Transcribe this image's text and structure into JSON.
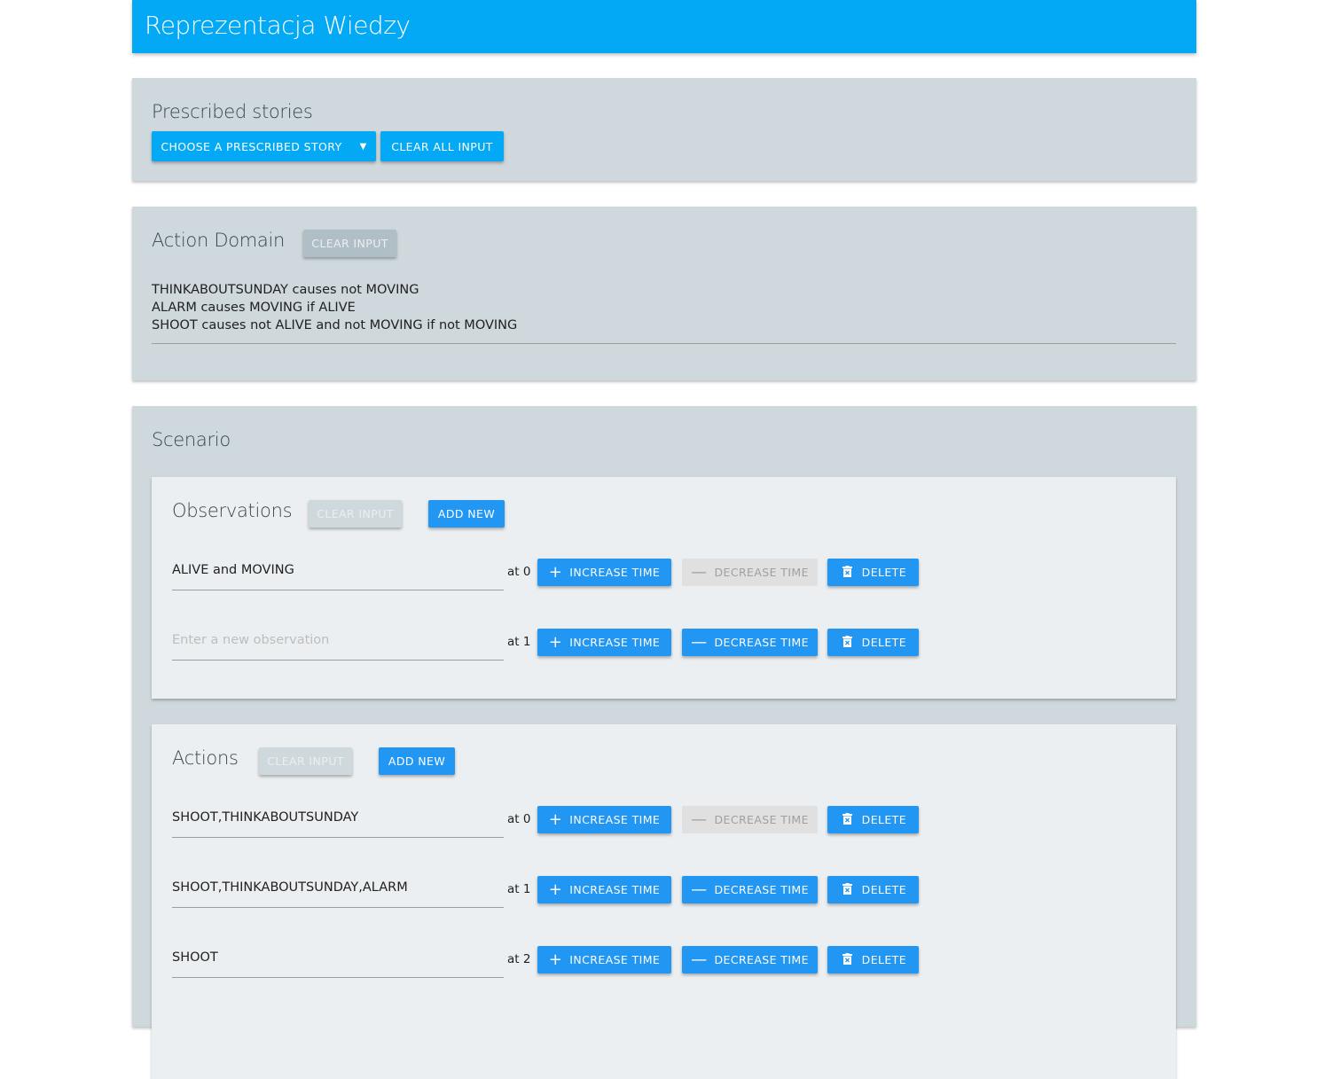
{
  "app": {
    "title": "Reprezentacja Wiedzy"
  },
  "stories": {
    "title": "Prescribed stories",
    "choose_label": "CHOOSE A PRESCRIBED STORY",
    "clear_all_label": "CLEAR ALL INPUT"
  },
  "domain": {
    "title": "Action Domain",
    "clear_label": "CLEAR INPUT",
    "lines": [
      "THINKABOUTSUNDAY causes not MOVING",
      "ALARM causes MOVING if ALIVE",
      "SHOOT causes not ALIVE and not MOVING if not MOVING"
    ]
  },
  "scenario": {
    "title": "Scenario"
  },
  "observations": {
    "title": "Observations",
    "clear_label": "CLEAR INPUT",
    "add_label": "ADD NEW",
    "rows": [
      {
        "value": "ALIVE and MOVING",
        "placeholder": "Enter a new observation",
        "time": "at 0",
        "decrease_disabled": true
      },
      {
        "value": "",
        "placeholder": "Enter a new observation",
        "time": "at 1",
        "decrease_disabled": false
      }
    ]
  },
  "actions": {
    "title": "Actions",
    "clear_label": "CLEAR INPUT",
    "add_label": "ADD NEW",
    "rows": [
      {
        "value": "SHOOT,THINKABOUTSUNDAY",
        "time": "at 0",
        "decrease_disabled": true
      },
      {
        "value": "SHOOT,THINKABOUTSUNDAY,ALARM",
        "time": "at 1",
        "decrease_disabled": false
      },
      {
        "value": "SHOOT",
        "time": "at 2",
        "decrease_disabled": false
      }
    ]
  },
  "row_buttons": {
    "increase": "INCREASE TIME",
    "decrease": "DECREASE TIME",
    "delete": "DELETE"
  },
  "icons": {
    "increase": "plus-icon",
    "decrease": "minus-icon",
    "delete": "trash-icon",
    "dropdown": "caret-down-icon"
  },
  "colors": {
    "header": "#03A9F4",
    "primary": "#2196F3",
    "card": "#CFD8DC",
    "inner": "#ECEFF1"
  }
}
